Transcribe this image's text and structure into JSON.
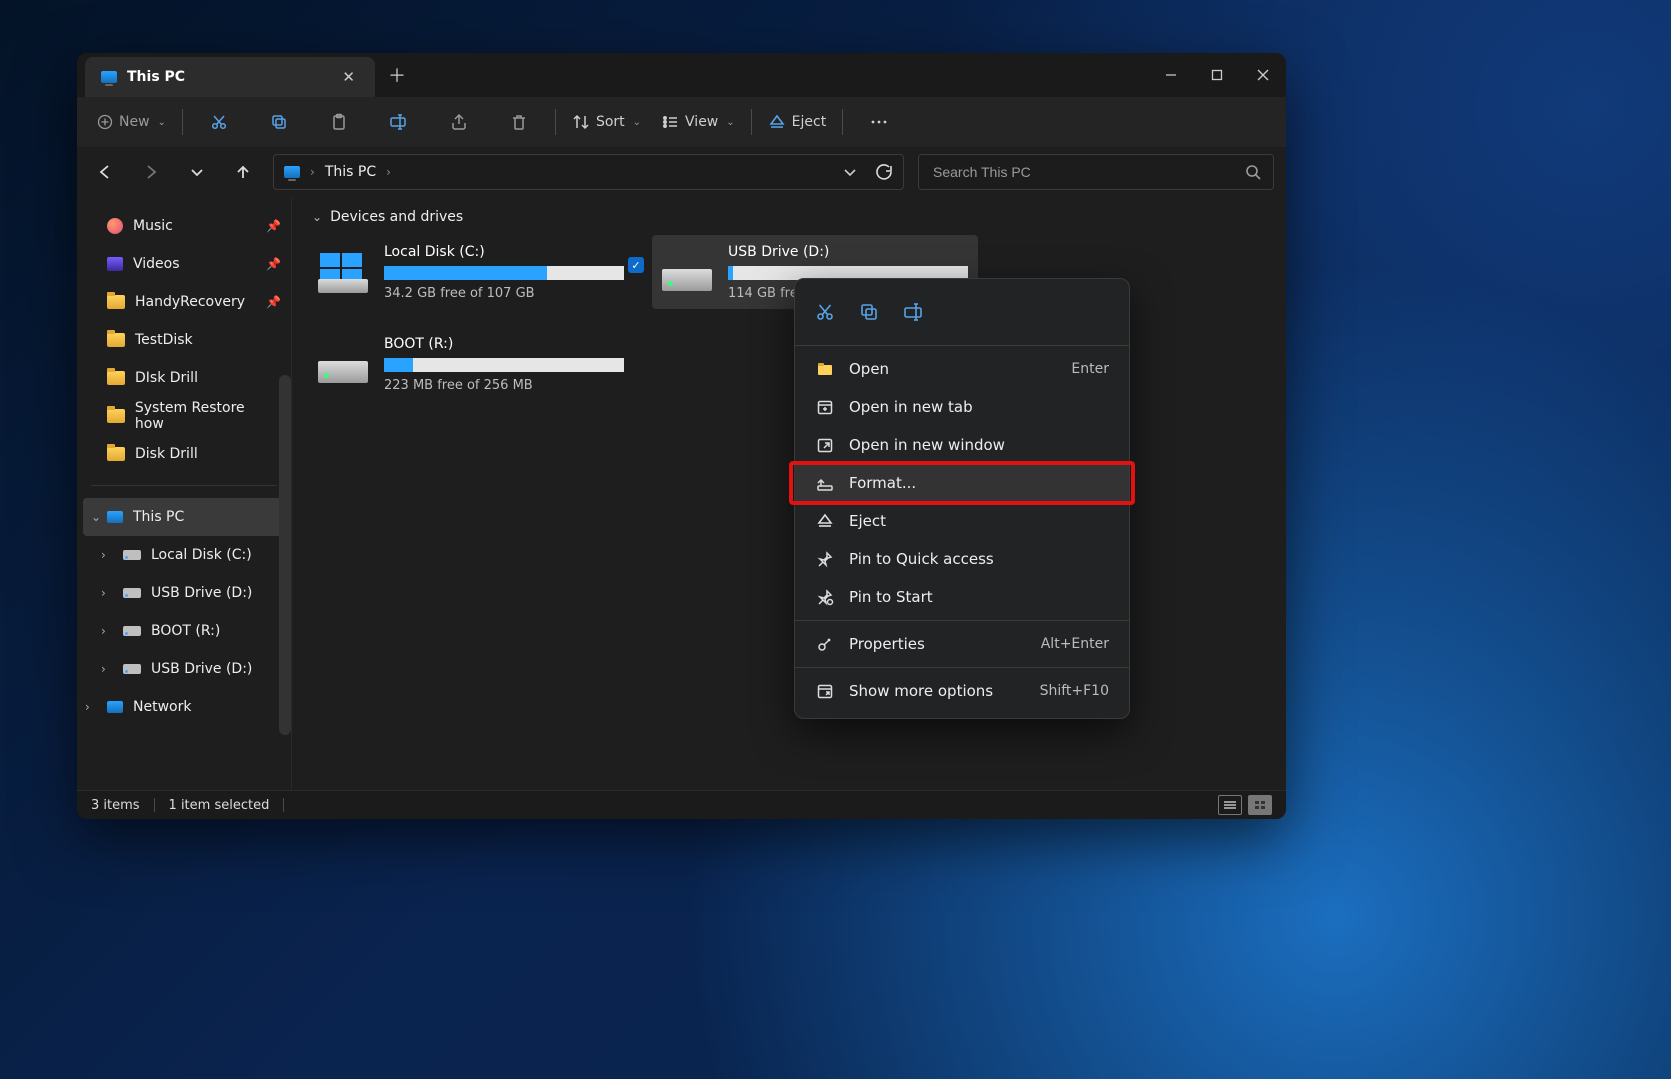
{
  "tab": {
    "title": "This PC"
  },
  "toolbar": {
    "new_label": "New",
    "sort_label": "Sort",
    "view_label": "View",
    "eject_label": "Eject"
  },
  "address": {
    "crumb": "This PC"
  },
  "search": {
    "placeholder": "Search This PC"
  },
  "sidebar": {
    "items": [
      {
        "label": "Music",
        "kind": "music",
        "pinned": true
      },
      {
        "label": "Videos",
        "kind": "video",
        "pinned": true
      },
      {
        "label": "HandyRecovery",
        "kind": "folder",
        "pinned": true
      },
      {
        "label": "TestDisk",
        "kind": "folder"
      },
      {
        "label": "DIsk Drill",
        "kind": "folder"
      },
      {
        "label": "System Restore how",
        "kind": "folder"
      },
      {
        "label": "Disk Drill",
        "kind": "folder"
      }
    ],
    "tree": [
      {
        "label": "This PC",
        "kind": "pc",
        "selected": true,
        "expander": "⌄"
      },
      {
        "label": "Local Disk (C:)",
        "kind": "drive",
        "sub": true,
        "expander": "›"
      },
      {
        "label": "USB Drive (D:)",
        "kind": "drive",
        "sub": true,
        "expander": "›"
      },
      {
        "label": "BOOT (R:)",
        "kind": "drive",
        "sub": true,
        "expander": "›"
      },
      {
        "label": "USB Drive (D:)",
        "kind": "drive",
        "sub": true,
        "expander": "›"
      },
      {
        "label": "Network",
        "kind": "net",
        "expander": "›"
      }
    ]
  },
  "main": {
    "group_header": "Devices and drives",
    "drives": [
      {
        "name": "Local Disk (C:)",
        "free_text": "34.2 GB free of 107 GB",
        "fill_pct": 68,
        "icon": "win",
        "selected": false
      },
      {
        "name": "USB Drive (D:)",
        "free_text": "114 GB free of 114 GB",
        "fill_pct": 2,
        "icon": "drive",
        "selected": true
      },
      {
        "name": "BOOT (R:)",
        "free_text": "223 MB free of 256 MB",
        "fill_pct": 12,
        "icon": "drive",
        "selected": false
      }
    ]
  },
  "context_menu": {
    "items": [
      {
        "label": "Open",
        "shortcut": "Enter",
        "icon": "open"
      },
      {
        "label": "Open in new tab",
        "icon": "newtab"
      },
      {
        "label": "Open in new window",
        "icon": "newwin"
      },
      {
        "label": "Format...",
        "icon": "format",
        "highlight": true
      },
      {
        "label": "Eject",
        "icon": "eject"
      },
      {
        "label": "Pin to Quick access",
        "icon": "pin"
      },
      {
        "label": "Pin to Start",
        "icon": "pinstart"
      },
      {
        "label": "Properties",
        "shortcut": "Alt+Enter",
        "icon": "props",
        "sep_before": true
      },
      {
        "label": "Show more options",
        "shortcut": "Shift+F10",
        "icon": "more",
        "sep_before": true
      }
    ]
  },
  "status": {
    "items_text": "3 items",
    "selected_text": "1 item selected"
  }
}
